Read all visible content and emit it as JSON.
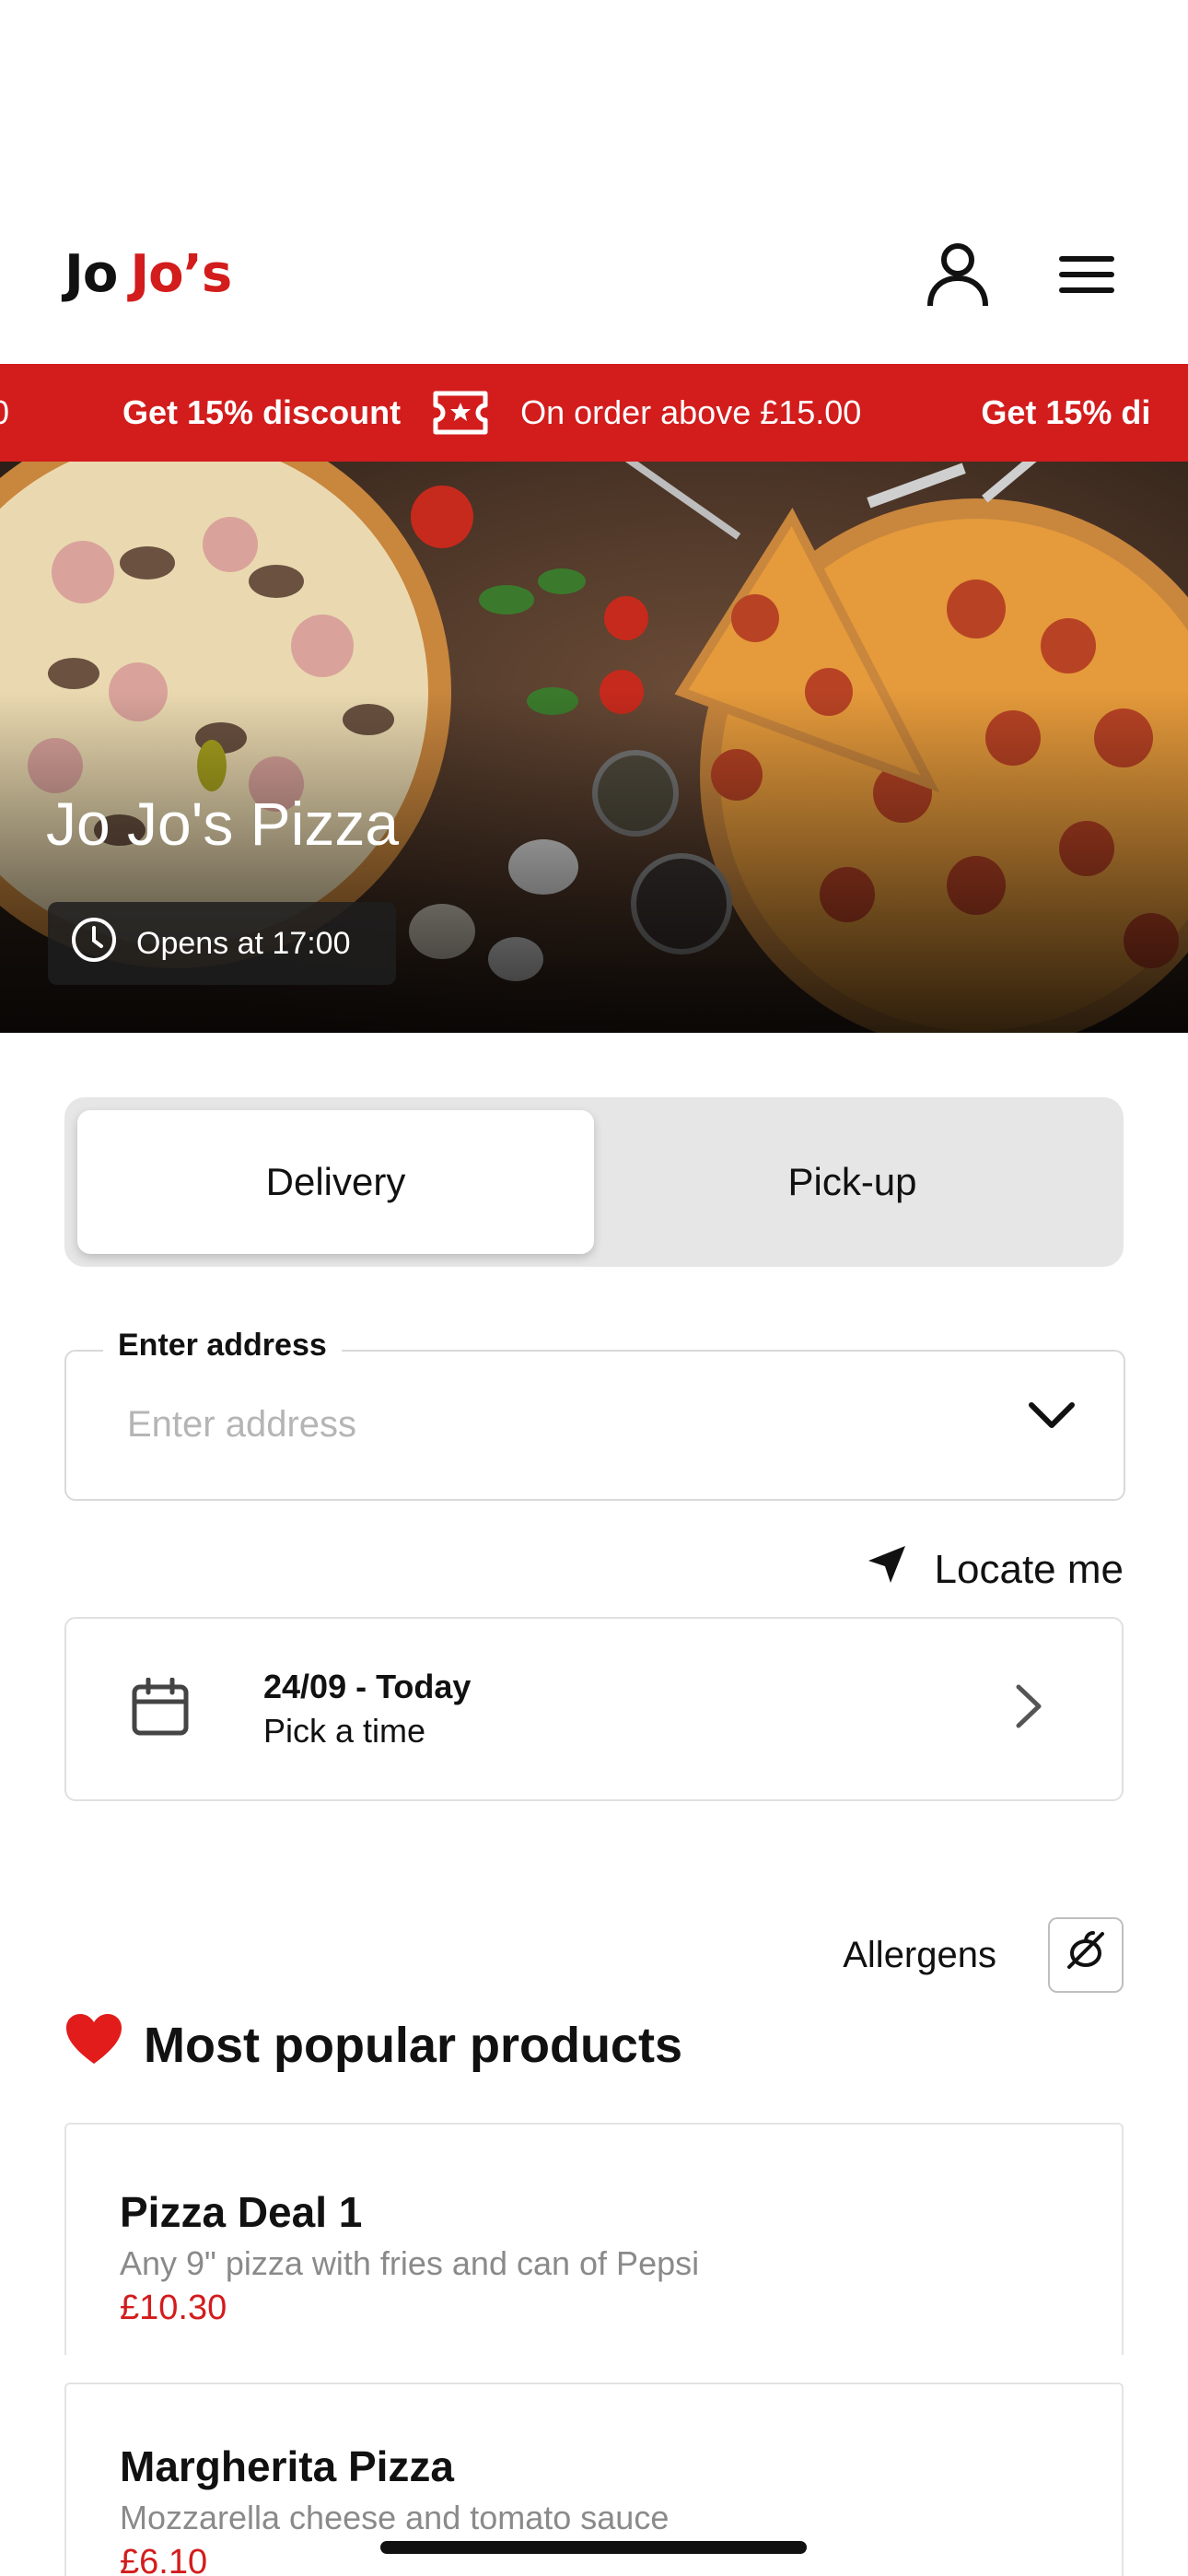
{
  "header": {
    "logo_part1": "Jo",
    "logo_part2": "Jo’s"
  },
  "promo": {
    "title": "Get 15% discount",
    "subtitle": "On order above £15.00",
    "title_repeat": "Get 15% di"
  },
  "hero": {
    "restaurant_name": "Jo Jo's Pizza",
    "opening_status": "Opens at 17:00"
  },
  "order_mode": {
    "options": [
      "Delivery",
      "Pick-up"
    ],
    "selected": "Delivery"
  },
  "address": {
    "label": "Enter address",
    "placeholder": "Enter address",
    "value": ""
  },
  "locate_label": "Locate me",
  "schedule": {
    "date": "24/09 - Today",
    "time_prompt": "Pick a time"
  },
  "allergens_label": "Allergens",
  "popular": {
    "emoji": "❤️",
    "title": "Most popular products",
    "products": [
      {
        "name": "Pizza Deal 1",
        "description": "Any 9\" pizza with fries and can of Pepsi",
        "price": "£10.30"
      },
      {
        "name": "Margherita Pizza",
        "description": "Mozzarella cheese and tomato sauce",
        "price": "£6.10"
      }
    ]
  },
  "colors": {
    "brand_red": "#d31c1c",
    "toggle_bg": "#e6e6e6"
  },
  "icons": [
    "user-icon",
    "menu-icon",
    "ticket-icon",
    "clock-icon",
    "chevron-down-icon",
    "location-arrow-icon",
    "calendar-icon",
    "chevron-right-icon",
    "allergen-icon",
    "heart-icon"
  ]
}
